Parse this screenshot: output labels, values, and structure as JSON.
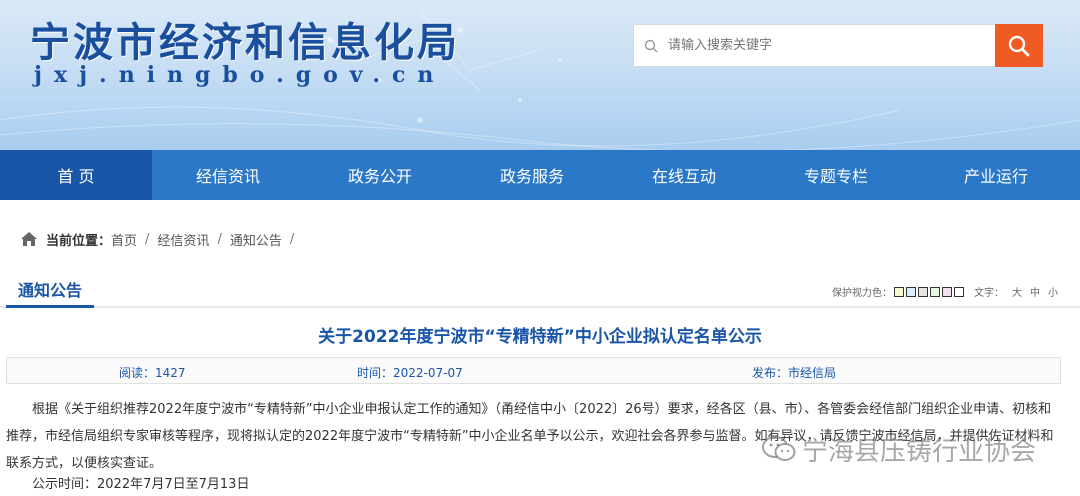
{
  "header": {
    "site_title": "宁波市经济和信息化局",
    "site_domain": "jxj.ningbo.gov.cn",
    "search_placeholder": "请输入搜索关键字"
  },
  "nav": {
    "items": [
      "首 页",
      "经信资讯",
      "政务公开",
      "政务服务",
      "在线互动",
      "专题专栏",
      "产业运行"
    ],
    "active_index": 0
  },
  "breadcrumb": {
    "label": "当前位置：",
    "items": [
      "首页",
      "经信资讯",
      "通知公告"
    ]
  },
  "section": {
    "title": "通知公告",
    "eye_protect_label": "保护视力色：",
    "swatch_colors": [
      "#fafad2",
      "#dbeeff",
      "#e6e6e6",
      "#eaf5e0",
      "#f2dff2",
      "#ffffff"
    ],
    "font_label": "文字：",
    "font_sizes": [
      "大",
      "中",
      "小"
    ]
  },
  "article": {
    "title": "关于2022年度宁波市“专精特新”中小企业拟认定名单公示",
    "reads": "阅读：1427",
    "time": "时间：2022-07-07",
    "publisher": "发布：市经信局",
    "body": "根据《关于组织推荐2022年度宁波市“专精特新”中小企业申报认定工作的通知》（甬经信中小〔2022〕26号）要求，经各区（县、市）、各管委会经信部门组织企业申请、初核和推荐，市经信局组织专家审核等程序，现将拟认定的2022年度宁波市“专精特新”中小企业名单予以公示，欢迎社会各界参与监督。如有异议，请反馈宁波市经信局，并提供佐证材料和联系方式，以便核实查证。",
    "public_period": "公示时间：2022年7月7日至7月13日"
  },
  "watermark": {
    "text": "宁海县压铸行业协会"
  },
  "colors": {
    "nav_bg": "#2b78c8",
    "nav_active": "#1a56a8",
    "accent_blue": "#1a56a8",
    "search_btn": "#f05a23"
  },
  "icons": {
    "search": "search-icon",
    "home": "home-icon",
    "wechat": "wechat-icon"
  }
}
